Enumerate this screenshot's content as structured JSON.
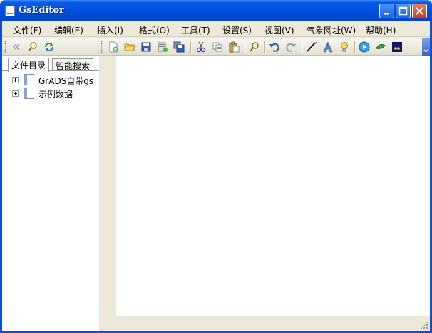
{
  "window": {
    "title": "GsEditor"
  },
  "menu": [
    {
      "label": "文件(F)"
    },
    {
      "label": "编辑(E)"
    },
    {
      "label": "插入(I)"
    },
    {
      "label": "格式(O)"
    },
    {
      "label": "工具(T)"
    },
    {
      "label": "设置(S)"
    },
    {
      "label": "视图(V)"
    },
    {
      "label": "气象网址(W)"
    },
    {
      "label": "帮助(H)"
    }
  ],
  "left_panel": {
    "tabs": [
      {
        "label": "文件目录",
        "active": true
      },
      {
        "label": "智能搜索",
        "active": false
      }
    ],
    "tree": [
      {
        "label": "GrADS自带gs"
      },
      {
        "label": "示例数据"
      }
    ]
  },
  "colors": {
    "titlebar": "#0053e1",
    "chrome": "#ece9d8",
    "editor_bg": "#ffffff"
  }
}
